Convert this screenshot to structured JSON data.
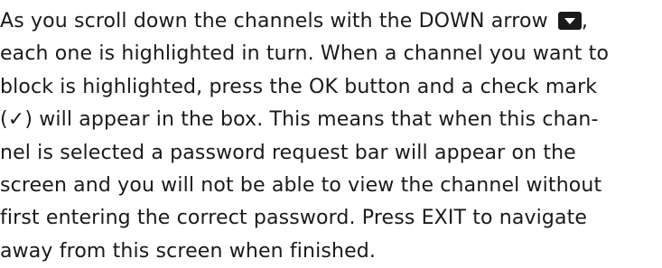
{
  "paragraph": {
    "line1_a": "As you scroll down the channels with the DOWN arrow",
    "line1_b": ",",
    "line2": "each one is highlighted in turn.  When a channel you want to",
    "line3": "block is highlighted, press the OK button and a check mark",
    "line4": "(✓) will appear in the box.  This means that when this chan-",
    "line5": "nel is selected a password request bar will appear on the",
    "line6": "screen and you will not be able to view the channel without",
    "line7": "first entering the correct password.  Press EXIT to navigate",
    "line8": "away from this screen when finished."
  },
  "icons": {
    "down_arrow": "down-arrow-button-icon"
  },
  "colors": {
    "text": "#1a1a1a",
    "icon_background": "#1a1a1a",
    "icon_glyph": "#ffffff"
  }
}
